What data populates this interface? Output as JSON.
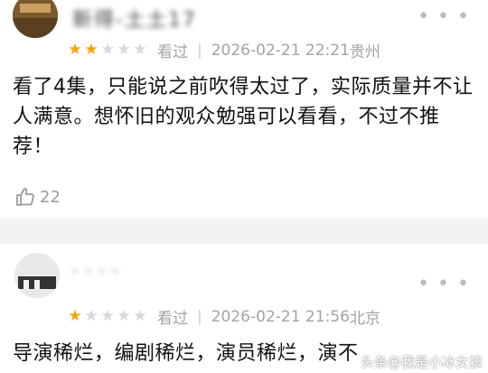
{
  "reviews": [
    {
      "username": "新得-土土17",
      "more_icon": "more-dots-icon",
      "rating": 2,
      "max_rating": 5,
      "status": "看过",
      "datetime": "2026-02-21 22:21",
      "location": "贵州",
      "text": "看了4集，只能说之前吹得太过了，实际质量并不让人满意。想怀旧的观众勉强可以看看，不过不推荐！",
      "likes": "22"
    },
    {
      "username": "- - - -",
      "more_icon": "more-dots-icon",
      "rating": 1,
      "max_rating": 5,
      "status": "看过",
      "datetime": "2026-02-21 21:56",
      "location": "北京",
      "text": "导演稀烂，编剧稀烂，演员稀烂，演不"
    }
  ],
  "watermark": "头条@我是小冰女孩",
  "colors": {
    "star_on": "#f4a500",
    "star_off": "#d8d8d8",
    "meta_text": "#a3a3a3"
  }
}
